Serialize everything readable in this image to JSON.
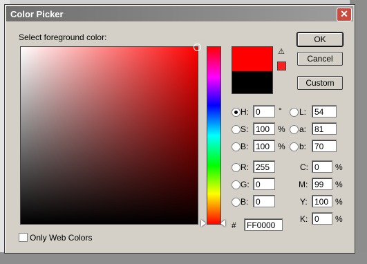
{
  "dialog": {
    "title": "Color Picker",
    "close_glyph": "✕",
    "prompt": "Select foreground color:",
    "buttons": {
      "ok": "OK",
      "cancel": "Cancel",
      "custom": "Custom"
    },
    "only_web_colors": "Only Web Colors",
    "warning_glyph": "⚠"
  },
  "hsb": {
    "h": {
      "label": "H:",
      "value": "0",
      "unit": "°"
    },
    "s": {
      "label": "S:",
      "value": "100",
      "unit": "%"
    },
    "b": {
      "label": "B:",
      "value": "100",
      "unit": "%"
    }
  },
  "rgb": {
    "r": {
      "label": "R:",
      "value": "255"
    },
    "g": {
      "label": "G:",
      "value": "0"
    },
    "b": {
      "label": "B:",
      "value": "0"
    }
  },
  "lab": {
    "l": {
      "label": "L:",
      "value": "54"
    },
    "a": {
      "label": "a:",
      "value": "81"
    },
    "b": {
      "label": "b:",
      "value": "70"
    }
  },
  "cmyk": {
    "c": {
      "label": "C:",
      "value": "0",
      "unit": "%"
    },
    "m": {
      "label": "M:",
      "value": "99",
      "unit": "%"
    },
    "y": {
      "label": "Y:",
      "value": "100",
      "unit": "%"
    },
    "k": {
      "label": "K:",
      "value": "0",
      "unit": "%"
    }
  },
  "hex": {
    "label": "#",
    "value": "FF0000"
  },
  "colors": {
    "new": "#ff0000",
    "old": "#000000"
  },
  "selected_mode": "H"
}
